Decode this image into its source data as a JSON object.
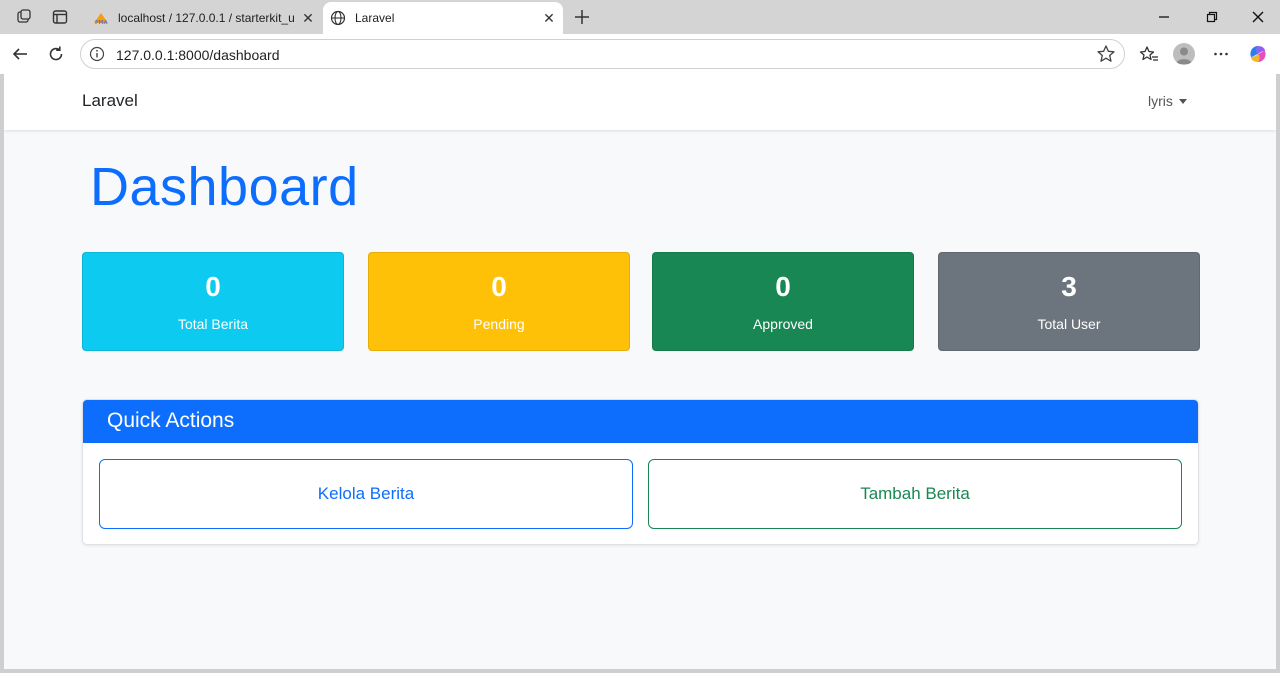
{
  "browser": {
    "tabs": [
      {
        "title": "localhost / 127.0.0.1 / starterkit_u",
        "favicon": "phpmyadmin-icon"
      },
      {
        "title": "Laravel",
        "favicon": "globe-icon"
      }
    ],
    "url": "127.0.0.1:8000/dashboard"
  },
  "navbar": {
    "brand": "Laravel",
    "user": "lyris"
  },
  "page": {
    "title": "Dashboard"
  },
  "stats": [
    {
      "value": "0",
      "label": "Total Berita",
      "color": "#0dcaf0"
    },
    {
      "value": "0",
      "label": "Pending",
      "color": "#ffc107"
    },
    {
      "value": "0",
      "label": "Approved",
      "color": "#198754"
    },
    {
      "value": "3",
      "label": "Total User",
      "color": "#6c757d"
    }
  ],
  "quick_actions": {
    "title": "Quick Actions",
    "buttons": [
      {
        "label": "Kelola Berita",
        "color": "#0d6efd"
      },
      {
        "label": "Tambah Berita",
        "color": "#198754"
      }
    ]
  }
}
